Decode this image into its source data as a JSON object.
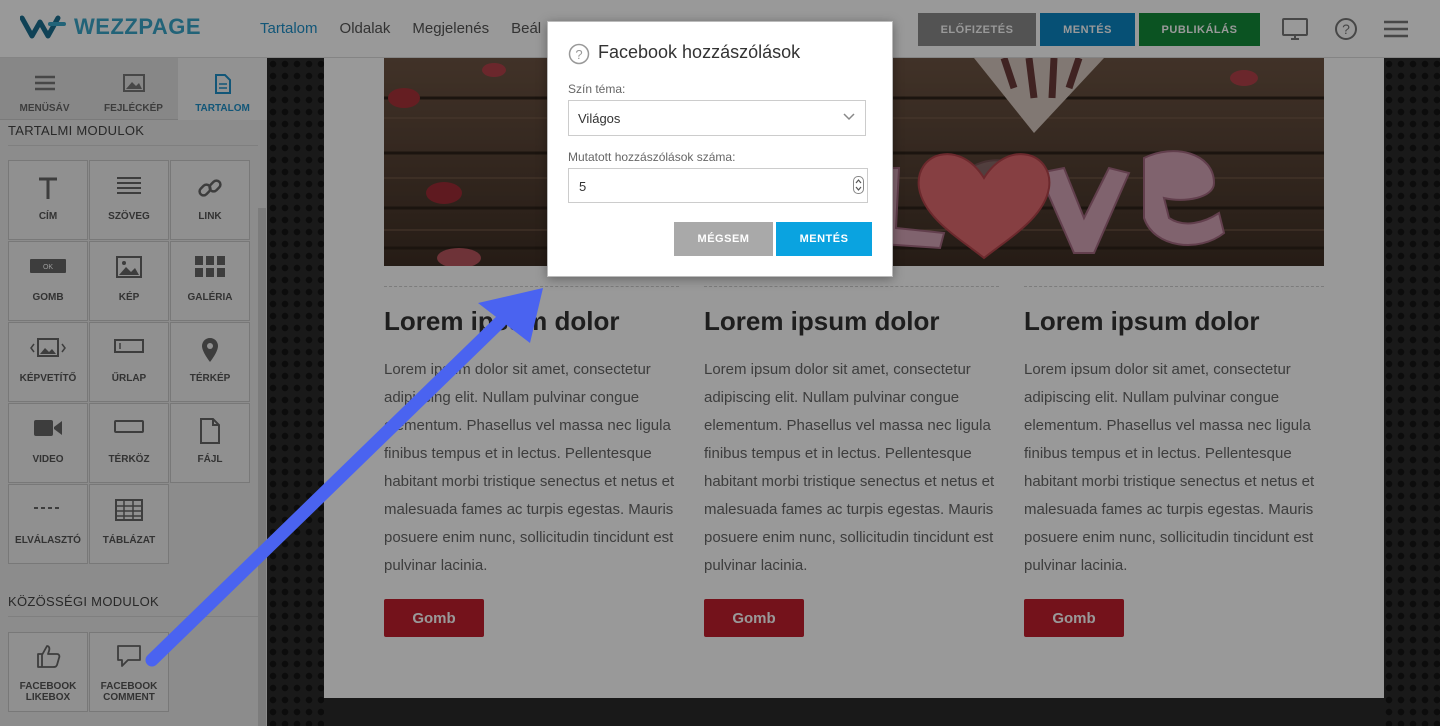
{
  "topbar": {
    "logo_text": "WEZZPAGE",
    "nav": [
      "Tartalom",
      "Oldalak",
      "Megjelenés",
      "Beál"
    ],
    "btn_subscription": "ELŐFIZETÉS",
    "btn_save": "MENTÉS",
    "btn_publish": "PUBLIKÁLÁS",
    "icons": [
      "monitor-icon",
      "help-icon",
      "hamburger-menu-icon"
    ]
  },
  "sidebar": {
    "tabs": [
      "MENÜSÁV",
      "FEJLÉCKÉP",
      "TARTALOM"
    ],
    "active_tab": "TARTALOM",
    "section_content": "TARTALMI MODULOK",
    "modules": [
      "CÍM",
      "SZÖVEG",
      "LINK",
      "GOMB",
      "KÉP",
      "GALÉRIA",
      "KÉPVETÍTŐ",
      "ŰRLAP",
      "TÉRKÉP",
      "VIDEO",
      "TÉRKÖZ",
      "FÁJL",
      "ELVÁLASZTÓ",
      "TÁBLÁZAT"
    ],
    "gomb_icon_text": "OK",
    "section_social": "KÖZÖSSÉGI MODULOK",
    "social_modules": [
      {
        "line1": "FACEBOOK",
        "line2": "LIKEBOX"
      },
      {
        "line1": "FACEBOOK",
        "line2": "COMMENT"
      }
    ]
  },
  "page": {
    "hero_word": "love",
    "columns": [
      {
        "title": "Lorem ipsum dolor",
        "text": "Lorem ipsum dolor sit amet, consectetur adipiscing elit. Nullam pulvinar congue elementum. Phasellus vel massa nec ligula finibus tempus et in lectus. Pellentesque habitant morbi tristique senectus et netus et malesuada fames ac turpis egestas. Mauris posuere enim nunc, sollicitudin tincidunt est pulvinar lacinia.",
        "button": "Gomb"
      },
      {
        "title": "Lorem ipsum dolor",
        "text": "Lorem ipsum dolor sit amet, consectetur adipiscing elit. Nullam pulvinar congue elementum. Phasellus vel massa nec ligula finibus tempus et in lectus. Pellentesque habitant morbi tristique senectus et netus et malesuada fames ac turpis egestas. Mauris posuere enim nunc, sollicitudin tincidunt est pulvinar lacinia.",
        "button": "Gomb"
      },
      {
        "title": "Lorem ipsum dolor",
        "text": "Lorem ipsum dolor sit amet, consectetur adipiscing elit. Nullam pulvinar congue elementum. Phasellus vel massa nec ligula finibus tempus et in lectus. Pellentesque habitant morbi tristique senectus et netus et malesuada fames ac turpis egestas. Mauris posuere enim nunc, sollicitudin tincidunt est pulvinar lacinia.",
        "button": "Gomb"
      }
    ]
  },
  "modal": {
    "title": "Facebook hozzászólások",
    "theme_label": "Szín téma:",
    "theme_value": "Világos",
    "count_label": "Mutatott hozzászólások száma:",
    "count_value": "5",
    "cancel": "MÉGSEM",
    "save": "MENTÉS"
  },
  "colors": {
    "brand": "#3aa6c9",
    "save_blue": "#0a86c4",
    "publish_green": "#138a3a",
    "modal_save": "#0aa3e0",
    "page_button": "#c21f2e",
    "annotation_arrow": "#4a63f0"
  }
}
